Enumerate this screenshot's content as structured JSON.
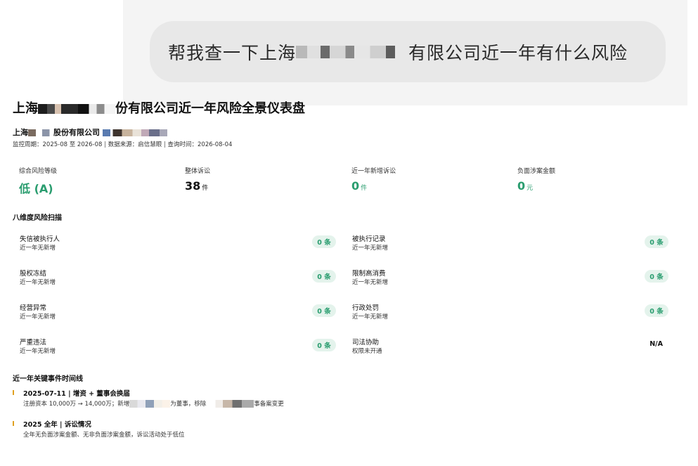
{
  "chat": {
    "prompt_prefix": "帮我查一下上海",
    "prompt_suffix": "有限公司近一年有什么风险"
  },
  "dashboard": {
    "title_prefix": "上海",
    "title_suffix": "份有限公司近一年风险全景仪表盘",
    "company_prefix": "上海",
    "company_mid": "股份有限公司",
    "meta": {
      "period": "监控周期：2025-08 至 2026-08",
      "source": "数据来源：启信慧眼",
      "query_time": "查询时间：2026-08-04",
      "sep": "|"
    },
    "metrics": [
      {
        "label": "综合风险等级",
        "value": "低 (A)",
        "unit": ""
      },
      {
        "label": "整体诉讼",
        "value": "38",
        "unit": "件"
      },
      {
        "label": "近一年新增诉讼",
        "value": "0",
        "unit": "件"
      },
      {
        "label": "负面涉案金额",
        "value": "0",
        "unit": "元"
      }
    ],
    "scan_title": "八维度风险扫描",
    "risks": [
      {
        "name": "失信被执行人",
        "sub": "近一年无新增",
        "badge": "0 条"
      },
      {
        "name": "被执行记录",
        "sub": "近一年无新增",
        "badge": "0 条"
      },
      {
        "name": "股权冻结",
        "sub": "近一年无新增",
        "badge": "0 条"
      },
      {
        "name": "限制高消费",
        "sub": "近一年无新增",
        "badge": "0 条"
      },
      {
        "name": "经营异常",
        "sub": "近一年无新增",
        "badge": "0 条"
      },
      {
        "name": "行政处罚",
        "sub": "近一年无新增",
        "badge": "0 条"
      },
      {
        "name": "严重违法",
        "sub": "近一年无新增",
        "badge": "0 条"
      },
      {
        "name": "司法协助",
        "sub": "权限未开通",
        "badge": "N/A"
      }
    ],
    "timeline_title": "近一年关键事件时间线",
    "timeline": [
      {
        "title": "2025-07-11 | 增资 + 董事会换届",
        "desc_a": "注册资本 10,000万 → 14,000万；新增",
        "desc_b": "为董事，移除",
        "desc_c": "事备案变更"
      },
      {
        "title": "2025 全年 | 诉讼情况",
        "desc": "全年无负面涉案金额、无非负面涉案金额，诉讼活动处于低位"
      }
    ]
  },
  "colors": {
    "accent_green": "#2a9d6f",
    "badge_bg": "#e4f3ec",
    "timeline_marker": "#e0a020",
    "chat_bg": "#f4f4f4",
    "bubble_bg": "#e8e8e8"
  }
}
